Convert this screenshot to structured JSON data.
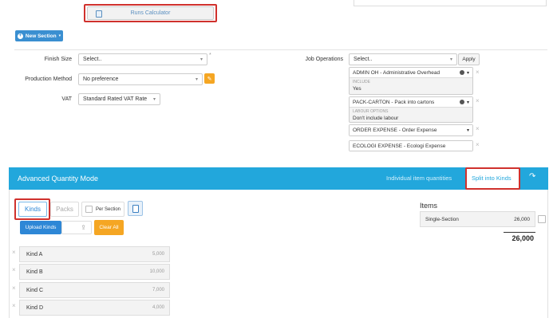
{
  "top": {
    "runs_calculator": "Runs Calculator",
    "new_section": "New Section"
  },
  "form": {
    "finish_size": {
      "label": "Finish Size",
      "value": "Select..",
      "asterisk": "*"
    },
    "production_method": {
      "label": "Production Method",
      "value": "No preference"
    },
    "vat": {
      "label": "VAT",
      "value": "Standard Rated VAT Rate"
    },
    "job_operations": {
      "label": "Job Operations",
      "value": "Select..",
      "apply": "Apply"
    }
  },
  "operations": [
    {
      "title": "ADMIN OH - Administrative Overhead",
      "sub_label": "INCLUDE",
      "sub_value": "Yes"
    },
    {
      "title": "PACK-CARTON - Pack into cartons",
      "sub_label": "LABOUR OPTIONS",
      "sub_value": "Don't include labour"
    },
    {
      "title": "ORDER EXPENSE - Order Expense"
    },
    {
      "title": "ECOLOGI EXPENSE - Ecologi Expense"
    }
  ],
  "aqm": {
    "title": "Advanced Quantity Mode",
    "individual": "Individual item quantities",
    "split": "Split into Kinds",
    "tabs": {
      "kinds": "Kinds",
      "packs": "Packs",
      "per_section": "Per Section"
    },
    "upload": "Upload Kinds",
    "clear": "Clear All",
    "kinds": [
      {
        "name": "Kind A",
        "qty": "5,000"
      },
      {
        "name": "Kind B",
        "qty": "10,000"
      },
      {
        "name": "Kind C",
        "qty": "7,000"
      },
      {
        "name": "Kind D",
        "qty": "4,000"
      }
    ],
    "items": {
      "title": "Items",
      "row_label": "Single-Section",
      "row_value": "26,000",
      "total": "26,000"
    }
  },
  "colors": {
    "header_blue": "#22a7dc",
    "red": "#d0312d",
    "orange": "#f5a623",
    "button_blue": "#2e87d6"
  }
}
